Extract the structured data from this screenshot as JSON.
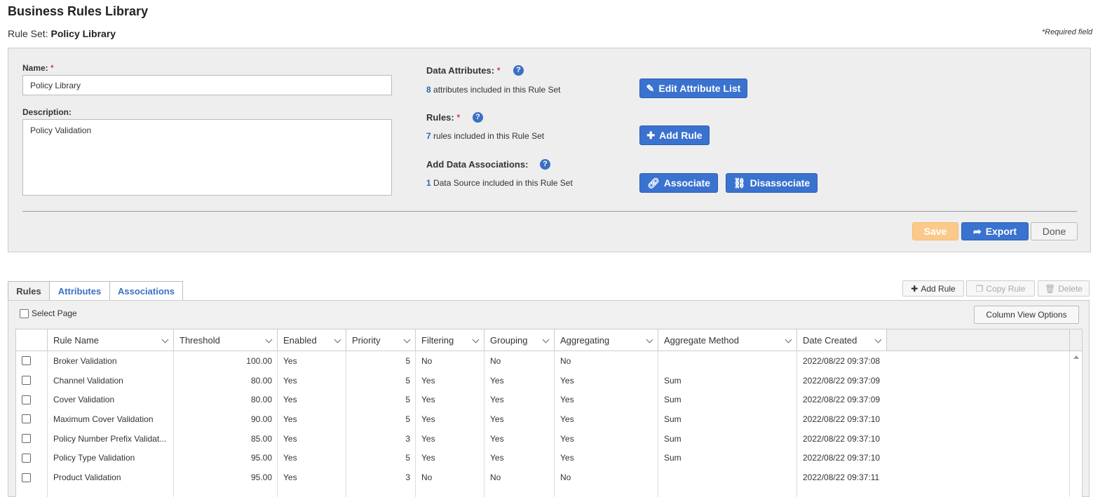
{
  "page": {
    "title": "Business Rules Library",
    "ruleset_label": "Rule Set:",
    "ruleset_name": "Policy Library",
    "required_note": "*Required field"
  },
  "form": {
    "name_label": "Name:",
    "required_star": "*",
    "name_value": "Policy Library",
    "description_label": "Description:",
    "description_value": "Policy Validation",
    "data_attributes_label": "Data Attributes:",
    "data_attributes_count": "8",
    "data_attributes_text": "attributes included in this Rule Set",
    "edit_attribute_button": "Edit Attribute List",
    "rules_label": "Rules:",
    "rules_count": "7",
    "rules_text": "rules included in this Rule Set",
    "add_rule_button": "Add Rule",
    "associations_label": "Add Data Associations:",
    "associations_count": "1",
    "associations_text": "Data Source included in this Rule Set",
    "associate_button": "Associate",
    "disassociate_button": "Disassociate",
    "help_glyph": "?",
    "save_button": "Save",
    "export_button": "Export",
    "done_button": "Done"
  },
  "tabs": [
    {
      "label": "Rules"
    },
    {
      "label": "Attributes"
    },
    {
      "label": "Associations"
    }
  ],
  "toolbar": {
    "add_rule": "Add Rule",
    "copy_rule": "Copy Rule",
    "delete": "Delete",
    "select_page": "Select Page",
    "column_view_options": "Column View Options"
  },
  "grid": {
    "columns": [
      "Rule Name",
      "Threshold",
      "Enabled",
      "Priority",
      "Filtering",
      "Grouping",
      "Aggregating",
      "Aggregate Method",
      "Date Created"
    ],
    "rows": [
      [
        "Broker Validation",
        "100.00",
        "Yes",
        "5",
        "No",
        "No",
        "No",
        "",
        "2022/08/22 09:37:08"
      ],
      [
        "Channel Validation",
        "80.00",
        "Yes",
        "5",
        "Yes",
        "Yes",
        "Yes",
        "Sum",
        "2022/08/22 09:37:09"
      ],
      [
        "Cover Validation",
        "80.00",
        "Yes",
        "5",
        "Yes",
        "Yes",
        "Yes",
        "Sum",
        "2022/08/22 09:37:09"
      ],
      [
        "Maximum Cover Validation",
        "90.00",
        "Yes",
        "5",
        "Yes",
        "Yes",
        "Yes",
        "Sum",
        "2022/08/22 09:37:10"
      ],
      [
        "Policy Number Prefix Validat...",
        "85.00",
        "Yes",
        "3",
        "Yes",
        "Yes",
        "Yes",
        "Sum",
        "2022/08/22 09:37:10"
      ],
      [
        "Policy Type Validation",
        "95.00",
        "Yes",
        "5",
        "Yes",
        "Yes",
        "Yes",
        "Sum",
        "2022/08/22 09:37:10"
      ],
      [
        "Product Validation",
        "95.00",
        "Yes",
        "3",
        "No",
        "No",
        "No",
        "",
        "2022/08/22 09:37:11"
      ]
    ]
  },
  "colors": {
    "accent": "#3a72cf",
    "save_disabled": "#fbc98a",
    "required": "#cc0000"
  }
}
